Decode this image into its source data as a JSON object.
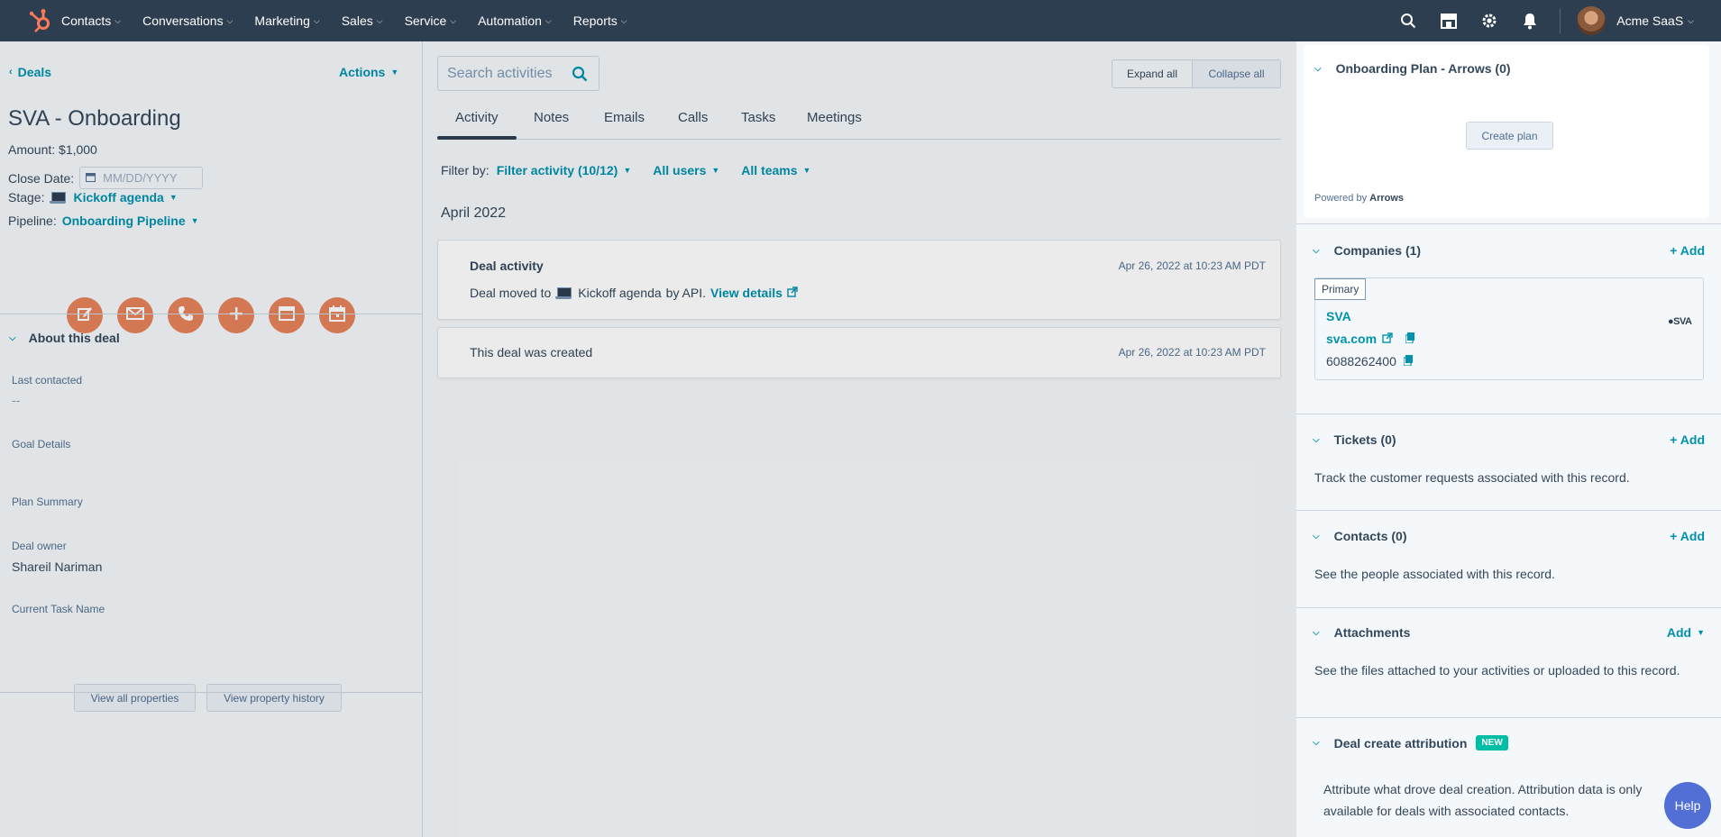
{
  "topnav": {
    "items": [
      "Contacts",
      "Conversations",
      "Marketing",
      "Sales",
      "Service",
      "Automation",
      "Reports"
    ],
    "account": "Acme SaaS"
  },
  "left": {
    "back_label": "Deals",
    "actions_label": "Actions",
    "title": "SVA - Onboarding",
    "amount": "Amount: $1,000",
    "close_date_label": "Close Date:",
    "close_date_placeholder": "MM/DD/YYYY",
    "stage_label": "Stage:",
    "stage_value": "Kickoff agenda",
    "pipeline_label": "Pipeline:",
    "pipeline_value": "Onboarding Pipeline",
    "about_title": "About this deal",
    "fields": [
      {
        "label": "Last contacted",
        "value": "--"
      },
      {
        "label": "Goal Details",
        "value": ""
      },
      {
        "label": "Plan Summary",
        "value": ""
      },
      {
        "label": "Deal owner",
        "value": "Shareil Nariman"
      },
      {
        "label": "Current Task Name",
        "value": ""
      }
    ],
    "view_all_label": "View all properties",
    "view_history_label": "View property history"
  },
  "middle": {
    "search_placeholder": "Search activities",
    "expand_label": "Expand all",
    "collapse_label": "Collapse all",
    "tabs": [
      "Activity",
      "Notes",
      "Emails",
      "Calls",
      "Tasks",
      "Meetings"
    ],
    "filter_by": "Filter by:",
    "filter_activity": "Filter activity (10/12)",
    "all_users": "All users",
    "all_teams": "All teams",
    "month": "April 2022",
    "activities": [
      {
        "title": "Deal activity",
        "time": "Apr 26, 2022 at 10:23 AM PDT",
        "text_before": "Deal moved to",
        "stage": "Kickoff agenda",
        "text_after": "by API.",
        "link": "View details"
      },
      {
        "title": "This deal was created",
        "time": "Apr 26, 2022 at 10:23 AM PDT"
      }
    ]
  },
  "right": {
    "onboarding_title": "Onboarding Plan - Arrows (0)",
    "create_plan_label": "Create plan",
    "powered_by": "Powered by",
    "powered_brand": "Arrows",
    "companies_title": "Companies (1)",
    "add_label": "+ Add",
    "primary_tag": "Primary",
    "company_name": "SVA",
    "company_domain": "sva.com",
    "company_phone": "6088262400",
    "company_logo_text": "SVA",
    "tickets_title": "Tickets (0)",
    "tickets_text": "Track the customer requests associated with this record.",
    "contacts_title": "Contacts (0)",
    "contacts_text": "See the people associated with this record.",
    "attachments_title": "Attachments",
    "attachments_add": "Add",
    "attachments_text": "See the files attached to your activities or uploaded to this record.",
    "attribution_title": "Deal create attribution",
    "attribution_badge": "NEW",
    "attribution_text_1": "Attribute what drove deal creation. Attribution data is only",
    "attribution_text_2": "available for deals with associated contacts.",
    "help_label": "Help"
  },
  "colors": {
    "nav_bg": "#2d3e50",
    "link": "#0091ae",
    "action_orange": "#e5835b",
    "new_badge": "#00bda5",
    "help": "#516fd4",
    "logo": "#ff7a59"
  }
}
